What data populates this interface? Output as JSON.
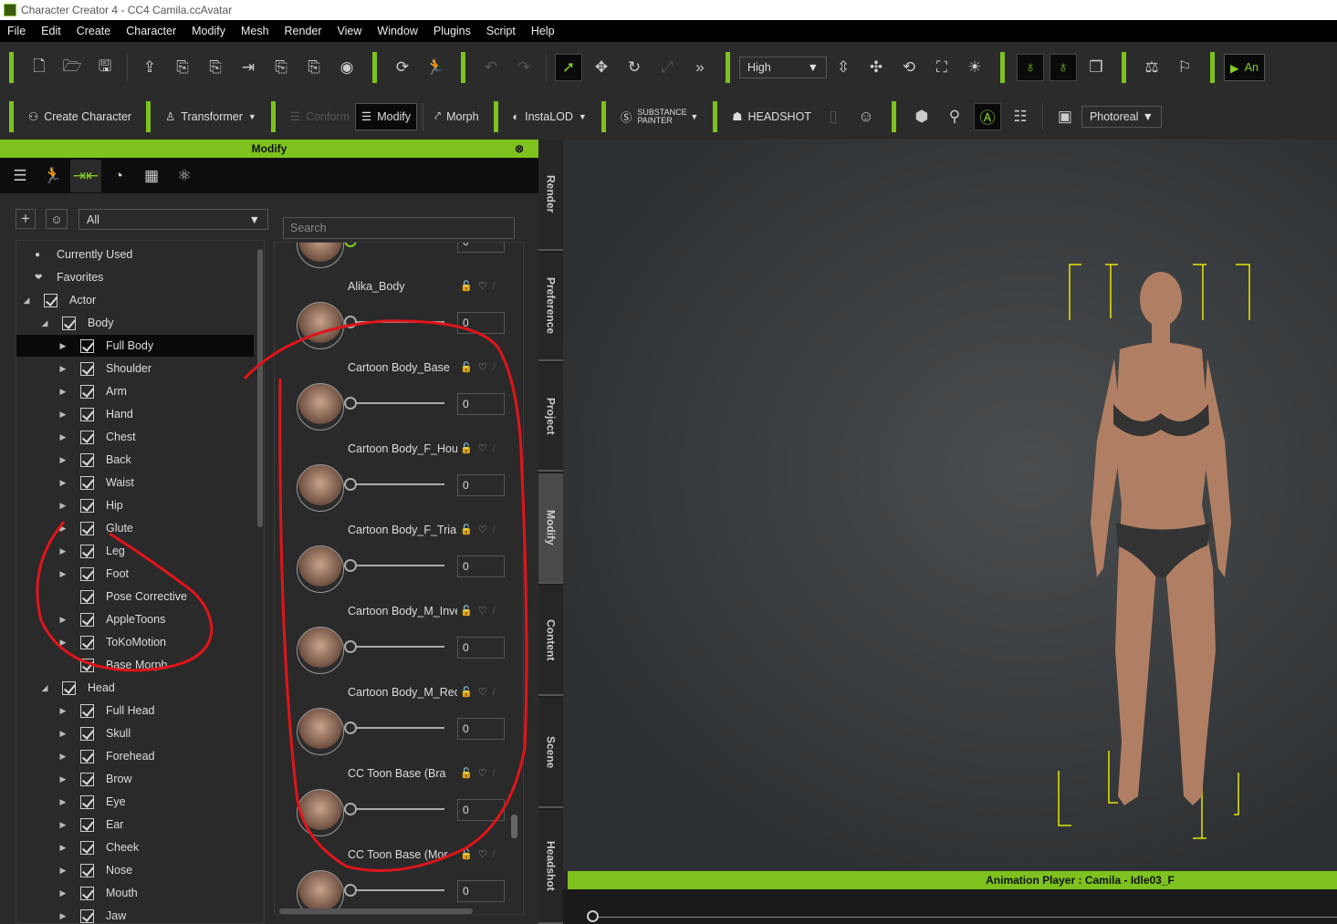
{
  "window": {
    "title": "Character Creator 4 - CC4 Camila.ccAvatar"
  },
  "menu": [
    "File",
    "Edit",
    "Create",
    "Character",
    "Modify",
    "Mesh",
    "Render",
    "View",
    "Window",
    "Plugins",
    "Script",
    "Help"
  ],
  "toolbar1": {
    "quality_select": "High",
    "anim_button": "An"
  },
  "toolbar2": {
    "create_character": "Create Character",
    "transformer": "Transformer",
    "conform": "Conform",
    "modify": "Modify",
    "morph": "Morph",
    "instalod": "InstaLOD",
    "substance": "SUBSTANCE PAINTER",
    "headshot": "HEADSHOT",
    "render_style": "Photoreal"
  },
  "left_panel": {
    "title": "Modify",
    "filter": "All",
    "search_placeholder": "Search"
  },
  "tree": [
    {
      "label": "Currently Used",
      "type": "bullet",
      "level": 0
    },
    {
      "label": "Favorites",
      "type": "heart",
      "level": 0
    },
    {
      "label": "Actor",
      "type": "open",
      "level": 0
    },
    {
      "label": "Body",
      "type": "open",
      "level": 1
    },
    {
      "label": "Full Body",
      "type": "closed",
      "level": 2,
      "selected": true
    },
    {
      "label": "Shoulder",
      "type": "closed",
      "level": 2
    },
    {
      "label": "Arm",
      "type": "closed",
      "level": 2
    },
    {
      "label": "Hand",
      "type": "closed",
      "level": 2
    },
    {
      "label": "Chest",
      "type": "closed",
      "level": 2
    },
    {
      "label": "Back",
      "type": "closed",
      "level": 2
    },
    {
      "label": "Waist",
      "type": "closed",
      "level": 2
    },
    {
      "label": "Hip",
      "type": "closed",
      "level": 2
    },
    {
      "label": "Glute",
      "type": "closed",
      "level": 2
    },
    {
      "label": "Leg",
      "type": "closed",
      "level": 2
    },
    {
      "label": "Foot",
      "type": "closed",
      "level": 2
    },
    {
      "label": "Pose Corrective",
      "type": "none",
      "level": 2
    },
    {
      "label": "AppleToons",
      "type": "closed",
      "level": 2
    },
    {
      "label": "ToKoMotion",
      "type": "closed",
      "level": 2
    },
    {
      "label": "Base Morph",
      "type": "none",
      "level": 2
    },
    {
      "label": "Head",
      "type": "open",
      "level": 1
    },
    {
      "label": "Full Head",
      "type": "closed",
      "level": 2
    },
    {
      "label": "Skull",
      "type": "closed",
      "level": 2
    },
    {
      "label": "Forehead",
      "type": "closed",
      "level": 2
    },
    {
      "label": "Brow",
      "type": "closed",
      "level": 2
    },
    {
      "label": "Eye",
      "type": "closed",
      "level": 2
    },
    {
      "label": "Ear",
      "type": "closed",
      "level": 2
    },
    {
      "label": "Cheek",
      "type": "closed",
      "level": 2
    },
    {
      "label": "Nose",
      "type": "closed",
      "level": 2
    },
    {
      "label": "Mouth",
      "type": "closed",
      "level": 2
    },
    {
      "label": "Jaw",
      "type": "closed",
      "level": 2
    }
  ],
  "morphs": [
    {
      "name": "",
      "value": "0",
      "active": true
    },
    {
      "name": "Alika_Body",
      "value": "0"
    },
    {
      "name": "Cartoon Body_Base",
      "value": "0"
    },
    {
      "name": "Cartoon Body_F_Hou",
      "value": "0"
    },
    {
      "name": "Cartoon Body_F_Tria",
      "value": "0"
    },
    {
      "name": "Cartoon Body_M_Inve",
      "value": "0"
    },
    {
      "name": "Cartoon Body_M_Rec",
      "value": "0"
    },
    {
      "name": "CC Toon Base (Bra",
      "value": "0"
    },
    {
      "name": "CC Toon Base (Mor",
      "value": "0"
    }
  ],
  "side_tabs": [
    "Render",
    "Preference",
    "Project",
    "Modify",
    "Content",
    "Scene",
    "Headshot"
  ],
  "animation_player": {
    "title": "Animation Player : Camila - Idle03_F"
  },
  "colors": {
    "accent": "#7dc21e",
    "annotation": "#e0141a",
    "bounding_box": "#e6e600"
  }
}
